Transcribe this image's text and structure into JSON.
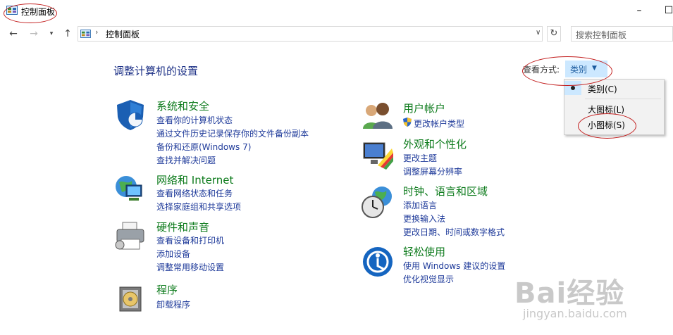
{
  "window": {
    "title": "控制面板"
  },
  "address": {
    "path": "控制面板",
    "search_placeholder": "搜索控制面板"
  },
  "main": {
    "heading": "调整计算机的设置",
    "viewby_label": "查看方式:",
    "viewby_value": "类别",
    "viewby_options": [
      "类别(C)",
      "大图标(L)",
      "小图标(S)"
    ]
  },
  "categories": [
    {
      "title": "系统和安全",
      "icon": "shield-icon",
      "links": [
        "查看你的计算机状态",
        "通过文件历史记录保存你的文件备份副本",
        "备份和还原(Windows 7)",
        "查找并解决问题"
      ]
    },
    {
      "title": "网络和 Internet",
      "icon": "network-globe-icon",
      "links": [
        "查看网络状态和任务",
        "选择家庭组和共享选项"
      ]
    },
    {
      "title": "硬件和声音",
      "icon": "printer-icon",
      "links": [
        "查看设备和打印机",
        "添加设备",
        "调整常用移动设置"
      ]
    },
    {
      "title": "程序",
      "icon": "programs-disc-icon",
      "links": [
        "卸载程序"
      ]
    },
    {
      "title": "用户帐户",
      "icon": "users-icon",
      "links": [
        "更改帐户类型"
      ]
    },
    {
      "title": "外观和个性化",
      "icon": "appearance-monitor-icon",
      "links": [
        "更改主题",
        "调整屏幕分辨率"
      ]
    },
    {
      "title": "时钟、语言和区域",
      "icon": "clock-globe-icon",
      "links": [
        "添加语言",
        "更换输入法",
        "更改日期、时间或数字格式"
      ]
    },
    {
      "title": "轻松使用",
      "icon": "ease-of-access-icon",
      "links": [
        "使用 Windows 建议的设置",
        "优化视觉显示"
      ]
    }
  ],
  "watermark": {
    "brand": "Bai经验",
    "url": "jingyan.baidu.com"
  },
  "colors": {
    "category_title": "#0d7b1c",
    "link": "#1e3a9a",
    "heading": "#1e3287",
    "highlight": "#cce8ff",
    "annotation": "#c21d1d"
  }
}
